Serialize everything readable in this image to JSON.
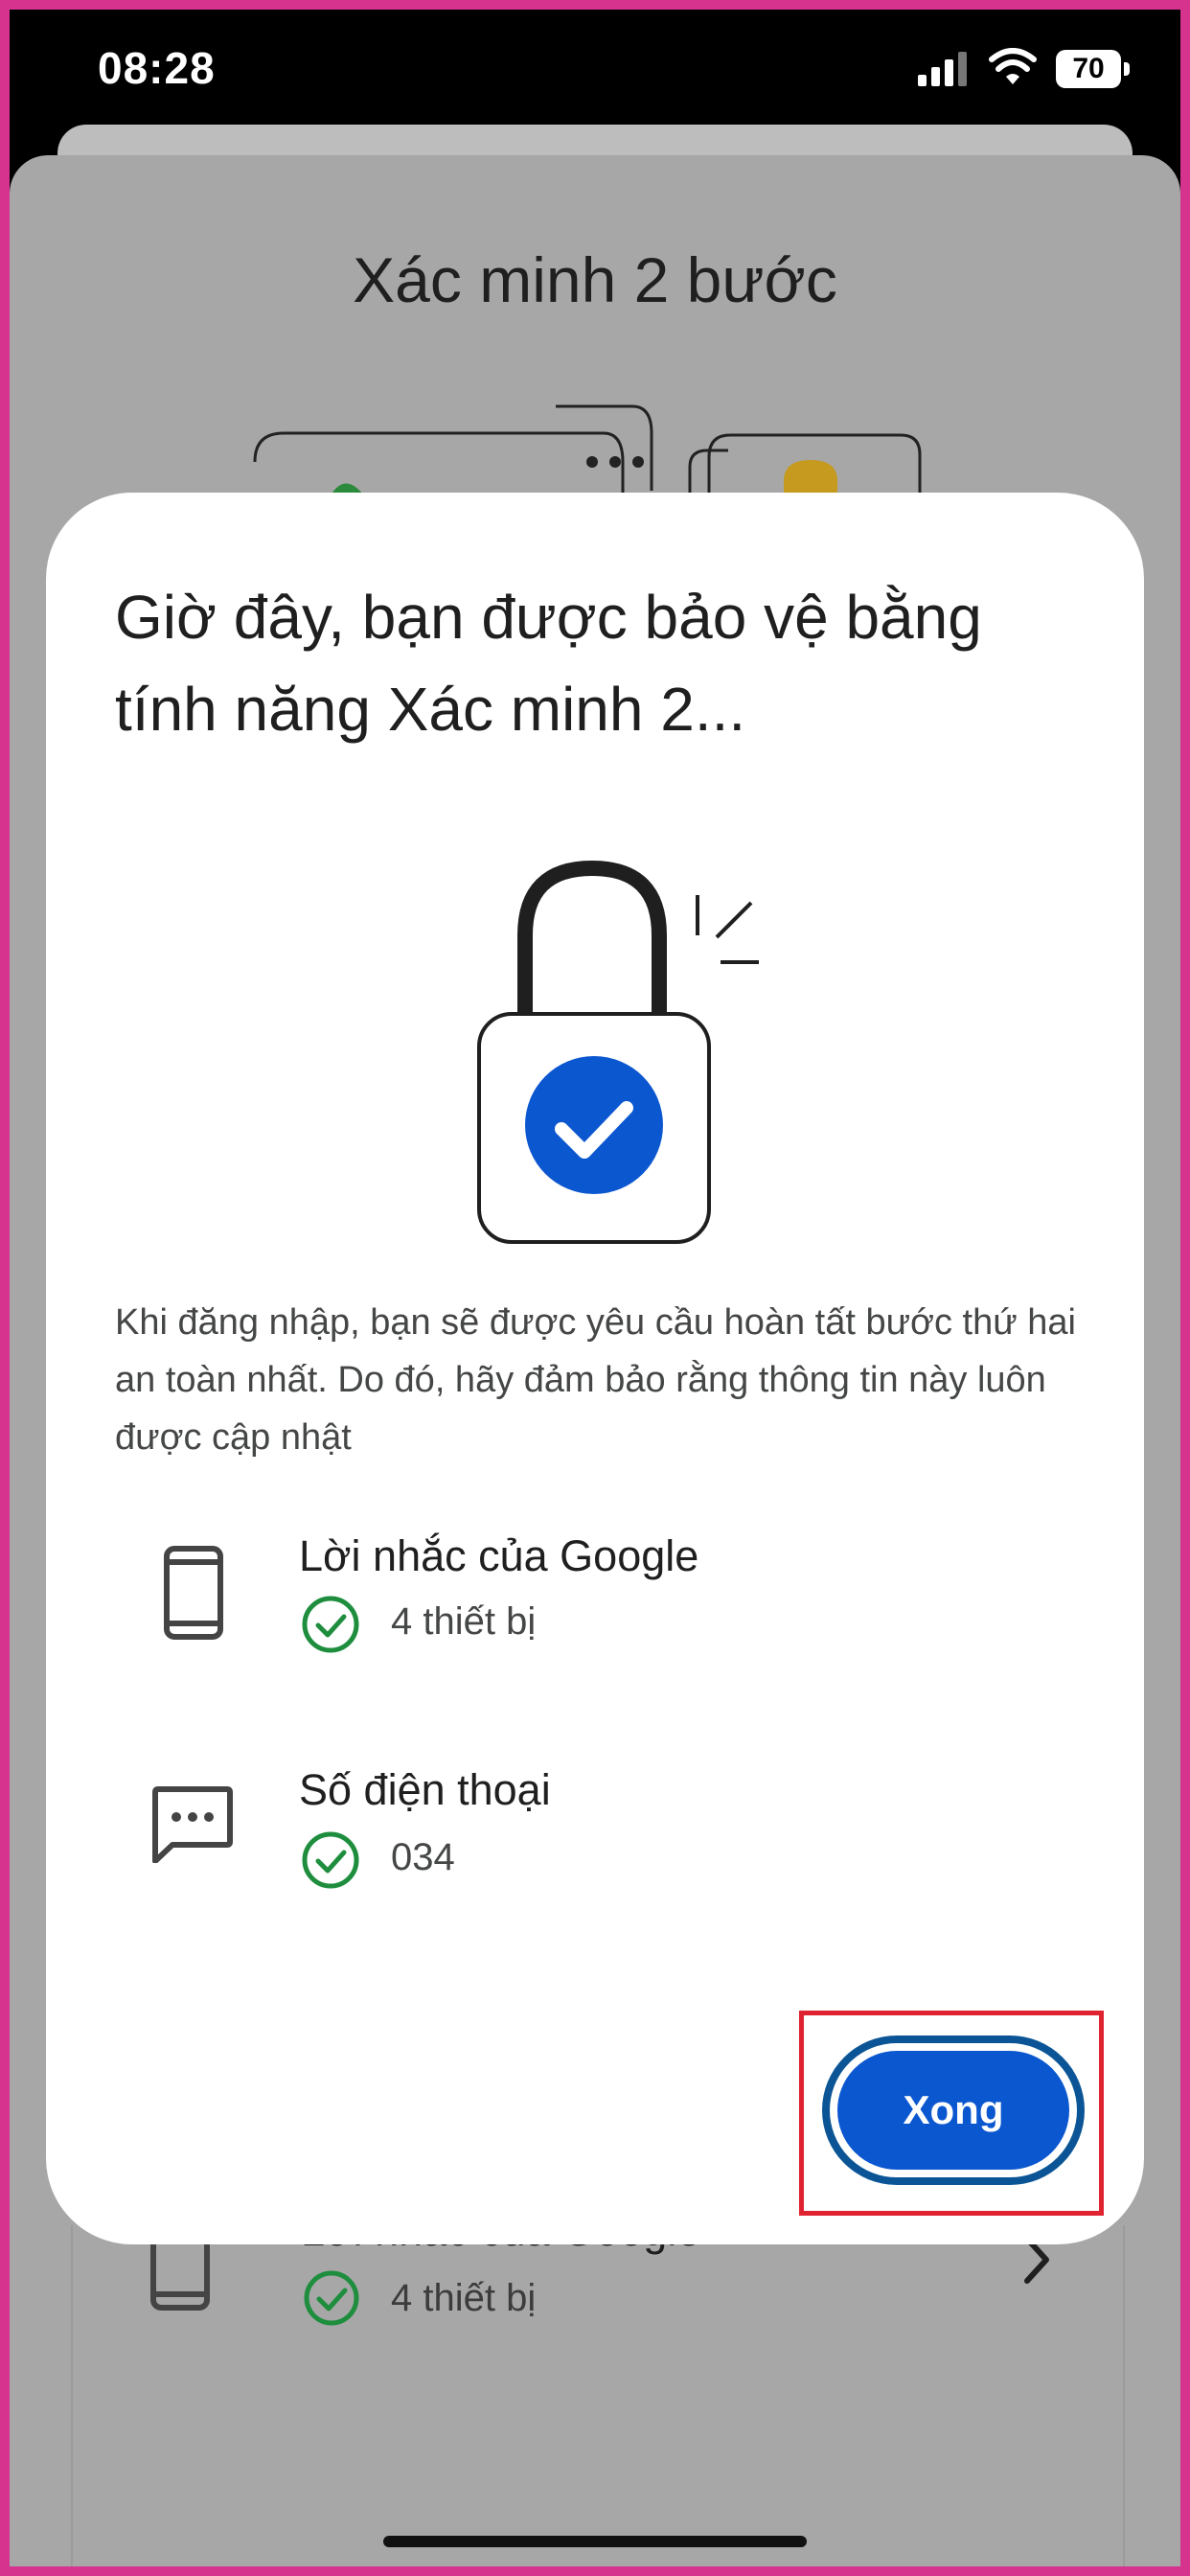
{
  "status_bar": {
    "time": "08:28",
    "battery": "70"
  },
  "background": {
    "title": "Xác minh 2 bước",
    "row": {
      "title": "Lời nhắc của Google",
      "subtitle": "4 thiết bị"
    }
  },
  "dialog": {
    "title": "Giờ đây, bạn được bảo vệ bằng tính năng Xác minh 2...",
    "body": "Khi đăng nhập, bạn sẽ được yêu cầu hoàn tất bước thứ hai an toàn nhất. Do đó, hãy đảm bảo rằng thông tin này luôn được cập nhật",
    "options": [
      {
        "title": "Lời nhắc của Google",
        "detail": "4 thiết bị",
        "icon": "phone-icon"
      },
      {
        "title": "Số điện thoại",
        "detail": "034",
        "icon": "message-icon"
      }
    ],
    "done_label": "Xong"
  },
  "colors": {
    "accent": "#0b57d0",
    "check_green": "#1e8e3e",
    "highlight": "#e02330"
  }
}
